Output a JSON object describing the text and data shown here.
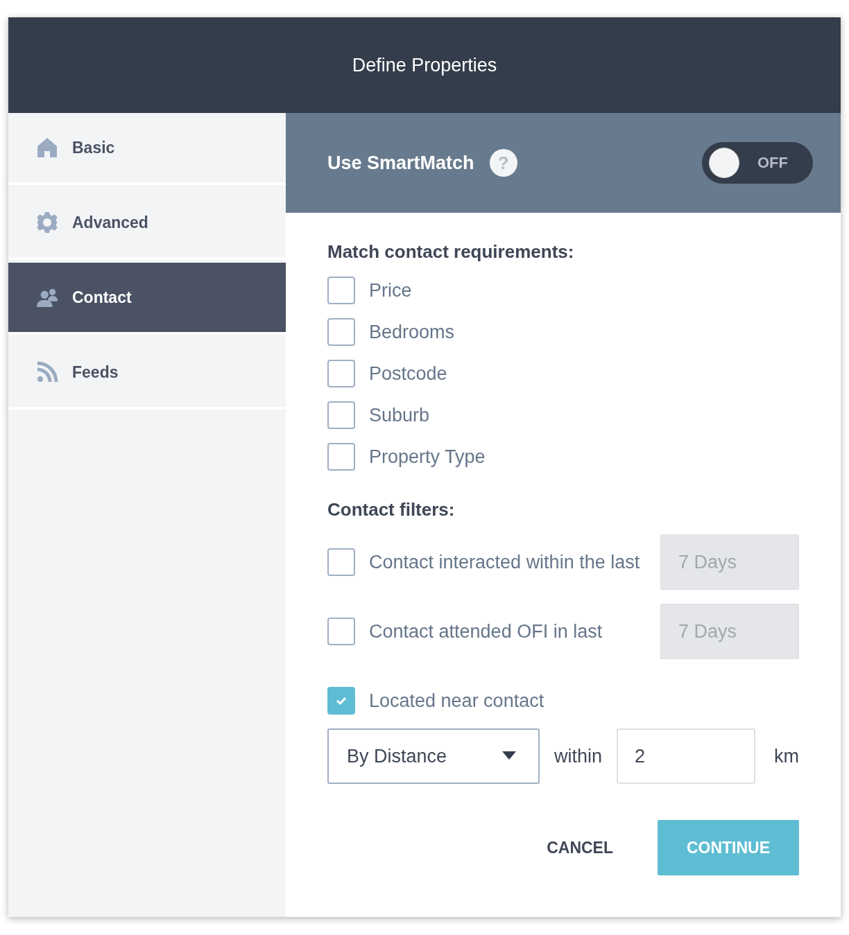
{
  "window": {
    "title": "Define Properties"
  },
  "sidebar": {
    "items": [
      {
        "label": "Basic",
        "kind": "home",
        "selected": false
      },
      {
        "label": "Advanced",
        "kind": "gear",
        "selected": false
      },
      {
        "label": "Contact",
        "kind": "contacts",
        "selected": true
      },
      {
        "label": "Feeds",
        "kind": "feed",
        "selected": false
      }
    ]
  },
  "smartmatch": {
    "label": "Use SmartMatch",
    "help": "?",
    "on": false,
    "state_label": "OFF"
  },
  "requirements": {
    "heading": "Match contact requirements:",
    "options": [
      {
        "label": "Price",
        "checked": false
      },
      {
        "label": "Bedrooms",
        "checked": false
      },
      {
        "label": "Postcode",
        "checked": false
      },
      {
        "label": "Suburb",
        "checked": false
      },
      {
        "label": "Property Type",
        "checked": false
      }
    ]
  },
  "filters": {
    "heading": "Contact filters:",
    "options": [
      {
        "kind": "days",
        "label": "Contact interacted within the last",
        "checked": false,
        "field": {
          "placeholder": "7 Days",
          "disabled": true
        }
      },
      {
        "kind": "days",
        "label": "Contact attended OFI in last",
        "checked": false,
        "field": {
          "placeholder": "7 Days",
          "disabled": true
        }
      },
      {
        "kind": "plain",
        "label": "Located near contact",
        "checked": true
      }
    ]
  },
  "distance": {
    "mode": "By Distance",
    "within": "within",
    "value": "2",
    "unit": "km"
  },
  "buttons": [
    {
      "label": "CANCEL",
      "kind": "text"
    },
    {
      "label": "CONTINUE",
      "kind": "primary"
    }
  ]
}
